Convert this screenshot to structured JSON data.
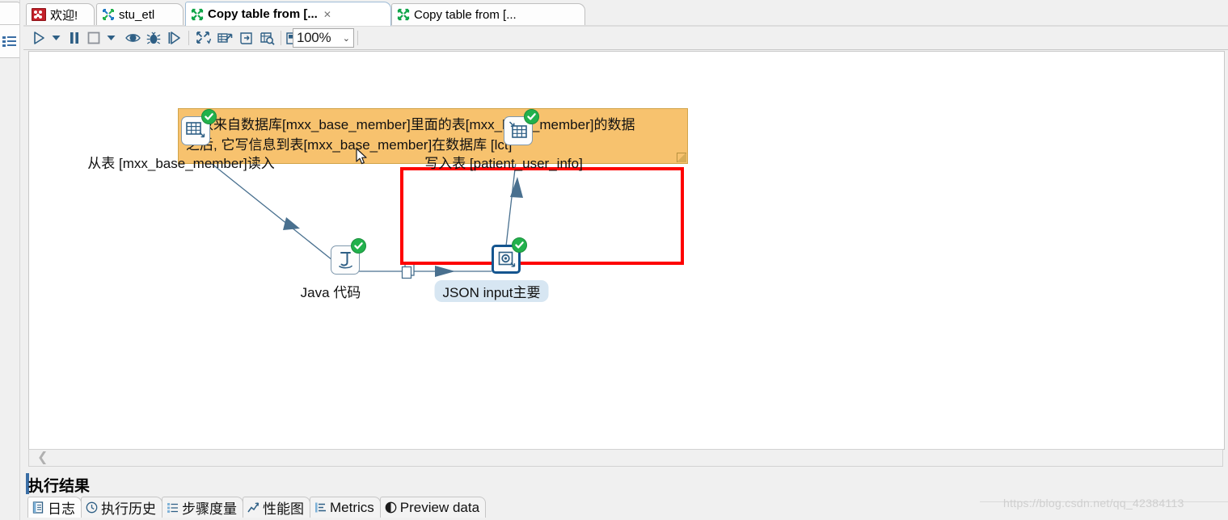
{
  "window": {
    "tabs": [
      {
        "label": "欢迎!",
        "icon": "welcome-icon",
        "active": false,
        "closable": false
      },
      {
        "label": "stu_etl",
        "icon": "transformation-icon-blue",
        "active": false,
        "closable": false
      },
      {
        "label": "Copy table from [...",
        "icon": "transformation-icon-green",
        "active": true,
        "closable": true
      },
      {
        "label": "Copy table from [...",
        "icon": "transformation-icon-green",
        "active": false,
        "closable": false
      }
    ],
    "tab_close_glyph": "✕"
  },
  "toolbar": {
    "items": [
      {
        "name": "run-button",
        "icon": "play-icon"
      },
      {
        "name": "run-options-dropdown",
        "icon": "chevron-down-icon"
      },
      {
        "name": "pause-button",
        "icon": "pause-icon"
      },
      {
        "name": "stop-button",
        "icon": "stop-icon"
      },
      {
        "name": "stop-options-dropdown",
        "icon": "chevron-down-icon"
      },
      {
        "name": "preview-button",
        "icon": "eye-icon"
      },
      {
        "name": "debug-button",
        "icon": "bug-icon"
      },
      {
        "name": "replay-button",
        "icon": "replay-icon"
      },
      {
        "name": "hide-inactive-hops-button",
        "icon": "collapse-arrows-icon"
      },
      {
        "name": "show-execution-results-button",
        "icon": "grid-arrow-icon"
      },
      {
        "name": "transformation-settings-button",
        "icon": "scroll-icon"
      },
      {
        "name": "inspect-data-button",
        "icon": "magnifier-grid-icon"
      },
      {
        "name": "align-snap-button",
        "icon": "align-icon"
      }
    ],
    "zoom": {
      "value": "100%",
      "chevron": "⌄"
    }
  },
  "canvas": {
    "note": {
      "line1": "读取来自数据库[mxx_base_member]里面的表[mxx_base_member]的数据",
      "line2": "之后, 它写信息到表[mxx_base_member]在数据库 [lct]",
      "background_color": "#f7c26e",
      "border_color": "#d1a44a"
    },
    "annotation": {
      "shape": "rectangle",
      "color": "#fe0000"
    },
    "steps": [
      {
        "name": "step-table-input",
        "label": "从表 [mxx_base_member]读入",
        "icon": "table-input-icon",
        "status": "ok",
        "selected": false,
        "highlighted_label": false
      },
      {
        "name": "step-table-output",
        "label": "写入表 [patient_user_info]",
        "icon": "table-output-icon",
        "status": "ok",
        "selected": false,
        "highlighted_label": false
      },
      {
        "name": "step-java-code",
        "label": "Java 代码",
        "icon": "java-code-icon",
        "status": "ok",
        "selected": false,
        "highlighted_label": false
      },
      {
        "name": "step-json-input",
        "label": "JSON input主要",
        "icon": "json-input-icon",
        "status": "ok",
        "selected": true,
        "highlighted_label": true
      }
    ],
    "hop_icon": "copy-rows-icon",
    "scrollbar_chevron": "❮"
  },
  "results": {
    "title": "执行结果",
    "tabs": [
      {
        "label": "日志",
        "icon": "log-icon",
        "active": true
      },
      {
        "label": "执行历史",
        "icon": "history-clock-icon",
        "active": false
      },
      {
        "label": "步骤度量",
        "icon": "step-metrics-icon",
        "active": false
      },
      {
        "label": "性能图",
        "icon": "performance-graph-icon",
        "active": false
      },
      {
        "label": "Metrics",
        "icon": "metrics-icon",
        "active": false
      },
      {
        "label": "Preview data",
        "icon": "preview-data-icon",
        "active": false
      }
    ]
  },
  "watermark": {
    "text": "https://blog.csdn.net/qq_42384113"
  }
}
